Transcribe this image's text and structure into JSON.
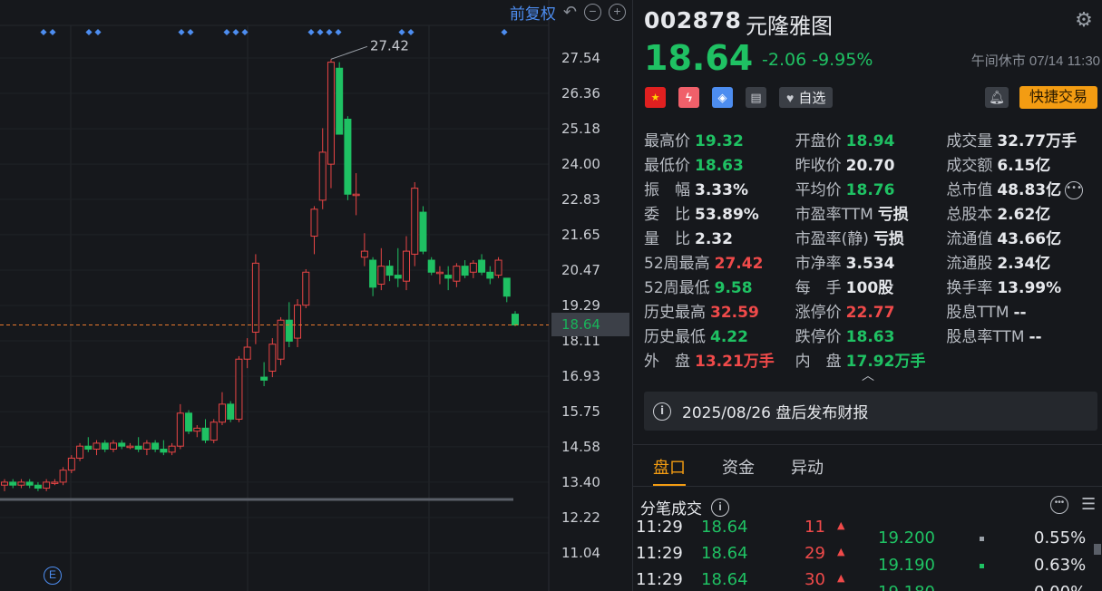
{
  "toolbar": {
    "adjust_label": "前复权"
  },
  "chart_data": {
    "type": "candlestick",
    "yticks": [
      "27.54",
      "26.36",
      "25.18",
      "24.00",
      "22.83",
      "21.65",
      "20.47",
      "19.29",
      "18.11",
      "16.93",
      "15.75",
      "14.58",
      "13.40",
      "12.22",
      "11.04"
    ],
    "ylim": [
      11.04,
      27.54
    ],
    "current_price": "18.64",
    "high_annotation": "27.42",
    "ohlc": [
      [
        13.3,
        13.5,
        13.1,
        13.4
      ],
      [
        13.4,
        13.5,
        13.2,
        13.3
      ],
      [
        13.3,
        13.5,
        13.2,
        13.4
      ],
      [
        13.4,
        13.5,
        13.2,
        13.3
      ],
      [
        13.3,
        13.4,
        13.1,
        13.2
      ],
      [
        13.2,
        13.5,
        13.1,
        13.4
      ],
      [
        13.4,
        13.5,
        13.3,
        13.4
      ],
      [
        13.4,
        13.9,
        13.3,
        13.8
      ],
      [
        13.8,
        14.3,
        13.7,
        14.2
      ],
      [
        14.2,
        14.7,
        14.1,
        14.6
      ],
      [
        14.6,
        14.9,
        14.4,
        14.5
      ],
      [
        14.5,
        14.8,
        14.3,
        14.7
      ],
      [
        14.7,
        14.8,
        14.4,
        14.5
      ],
      [
        14.5,
        14.8,
        14.4,
        14.7
      ],
      [
        14.7,
        14.8,
        14.5,
        14.6
      ],
      [
        14.6,
        14.7,
        14.5,
        14.6
      ],
      [
        14.6,
        14.9,
        14.4,
        14.5
      ],
      [
        14.5,
        14.8,
        14.3,
        14.7
      ],
      [
        14.7,
        14.8,
        14.4,
        14.5
      ],
      [
        14.5,
        14.8,
        14.3,
        14.4
      ],
      [
        14.4,
        14.7,
        14.3,
        14.6
      ],
      [
        14.6,
        16.0,
        14.5,
        15.7
      ],
      [
        15.7,
        15.8,
        15.0,
        15.1
      ],
      [
        15.1,
        15.3,
        14.9,
        15.2
      ],
      [
        15.2,
        15.5,
        14.7,
        14.8
      ],
      [
        14.8,
        15.5,
        14.7,
        15.4
      ],
      [
        15.4,
        16.4,
        15.3,
        16.0
      ],
      [
        16.0,
        16.1,
        15.4,
        15.5
      ],
      [
        15.5,
        17.6,
        15.4,
        17.5
      ],
      [
        17.5,
        18.2,
        17.2,
        17.9
      ],
      [
        18.4,
        21.0,
        18.0,
        20.7
      ],
      [
        16.9,
        17.4,
        16.6,
        16.8
      ],
      [
        17.1,
        18.2,
        16.9,
        18.0
      ],
      [
        17.5,
        18.9,
        17.3,
        18.8
      ],
      [
        18.8,
        19.4,
        17.9,
        18.1
      ],
      [
        18.2,
        19.5,
        17.9,
        19.3
      ],
      [
        19.3,
        20.5,
        19.2,
        20.4
      ],
      [
        21.6,
        22.6,
        21.0,
        22.5
      ],
      [
        22.8,
        25.2,
        22.5,
        24.4
      ],
      [
        24.0,
        27.5,
        23.2,
        27.4
      ],
      [
        27.2,
        27.4,
        25.0,
        25.0
      ],
      [
        25.5,
        25.6,
        22.8,
        23.0
      ],
      [
        23.0,
        23.7,
        22.3,
        23.0
      ],
      [
        20.9,
        21.7,
        20.6,
        21.1
      ],
      [
        20.8,
        20.9,
        19.6,
        19.9
      ],
      [
        20.0,
        21.2,
        19.8,
        20.6
      ],
      [
        20.6,
        20.8,
        20.1,
        20.3
      ],
      [
        20.3,
        21.2,
        19.9,
        20.2
      ],
      [
        20.1,
        21.6,
        19.8,
        21.1
      ],
      [
        21.0,
        23.4,
        20.6,
        23.2
      ],
      [
        22.4,
        22.6,
        21.0,
        21.1
      ],
      [
        20.8,
        20.9,
        20.3,
        20.4
      ],
      [
        20.4,
        20.6,
        20.0,
        20.4
      ],
      [
        20.3,
        20.6,
        19.8,
        20.2
      ],
      [
        20.1,
        20.7,
        19.9,
        20.6
      ],
      [
        20.6,
        20.8,
        20.2,
        20.3
      ],
      [
        20.4,
        20.8,
        20.2,
        20.7
      ],
      [
        20.8,
        21.0,
        20.3,
        20.4
      ],
      [
        20.4,
        20.6,
        20.0,
        20.2
      ],
      [
        20.3,
        20.9,
        20.2,
        20.8
      ],
      [
        20.2,
        20.2,
        19.4,
        19.6
      ],
      [
        19.0,
        19.1,
        18.6,
        18.64
      ]
    ]
  },
  "stock": {
    "code": "002878",
    "name": "元隆雅图",
    "price": "18.64",
    "change": "-2.06 -9.95%",
    "status_time": "午间休市 07/14 11:30"
  },
  "actions": {
    "watch_label": "自选",
    "trade_label": "快捷交易"
  },
  "stats": [
    [
      {
        "l": "最高价",
        "v": "19.32",
        "c": "g"
      },
      {
        "l": "开盘价",
        "v": "18.94",
        "c": "g"
      },
      {
        "l": "成交量",
        "v": "32.77万手",
        "c": "w"
      }
    ],
    [
      {
        "l": "最低价",
        "v": "18.63",
        "c": "g"
      },
      {
        "l": "昨收价",
        "v": "20.70",
        "c": "w"
      },
      {
        "l": "成交额",
        "v": "6.15亿",
        "c": "w"
      }
    ],
    [
      {
        "l": "振　幅",
        "v": "3.33%",
        "c": "w"
      },
      {
        "l": "平均价",
        "v": "18.76",
        "c": "g"
      },
      {
        "l": "总市值",
        "v": "48.83亿",
        "c": "w"
      }
    ],
    [
      {
        "l": "委　比",
        "v": "53.89%",
        "c": "w"
      },
      {
        "l": "市盈率TTM",
        "v": "亏损",
        "c": "w"
      },
      {
        "l": "总股本",
        "v": "2.62亿",
        "c": "w"
      }
    ],
    [
      {
        "l": "量　比",
        "v": "2.32",
        "c": "w"
      },
      {
        "l": "市盈率(静)",
        "v": "亏损",
        "c": "w"
      },
      {
        "l": "流通值",
        "v": "43.66亿",
        "c": "w"
      }
    ],
    [
      {
        "l": "52周最高",
        "v": "27.42",
        "c": "r"
      },
      {
        "l": "市净率",
        "v": "3.534",
        "c": "w"
      },
      {
        "l": "流通股",
        "v": "2.34亿",
        "c": "w"
      }
    ],
    [
      {
        "l": "52周最低",
        "v": "9.58",
        "c": "g"
      },
      {
        "l": "每　手",
        "v": "100股",
        "c": "w"
      },
      {
        "l": "换手率",
        "v": "13.99%",
        "c": "w"
      }
    ],
    [
      {
        "l": "历史最高",
        "v": "32.59",
        "c": "r"
      },
      {
        "l": "涨停价",
        "v": "22.77",
        "c": "r"
      },
      {
        "l": "股息TTM",
        "v": "--",
        "c": "w"
      }
    ],
    [
      {
        "l": "历史最低",
        "v": "4.22",
        "c": "g"
      },
      {
        "l": "跌停价",
        "v": "18.63",
        "c": "g"
      },
      {
        "l": "股息率TTM",
        "v": "--",
        "c": "w"
      }
    ],
    [
      {
        "l": "外　盘",
        "v": "13.21万手",
        "c": "r"
      },
      {
        "l": "内　盘",
        "v": "17.92万手",
        "c": "g"
      },
      null
    ]
  ],
  "notice": {
    "text": "2025/08/26  盘后发布财报"
  },
  "tabs": [
    {
      "label": "盘口",
      "active": true
    },
    {
      "label": "资金",
      "active": false
    },
    {
      "label": "异动",
      "active": false
    }
  ],
  "ticks_title": "分笔成交",
  "ticks": [
    {
      "time": "11:29",
      "price": "18.64",
      "vol": "11"
    },
    {
      "time": "11:29",
      "price": "18.64",
      "vol": "29"
    },
    {
      "time": "11:29",
      "price": "18.64",
      "vol": "30"
    }
  ],
  "depth": [
    {
      "price": "19.200",
      "pct": "0.55%",
      "bar_color": "#9aa0a8"
    },
    {
      "price": "19.190",
      "pct": "0.63%",
      "bar_color": "#1fc163"
    },
    {
      "price": "19.180",
      "pct": "0.00%",
      "bar_color": "#9aa0a8"
    }
  ]
}
